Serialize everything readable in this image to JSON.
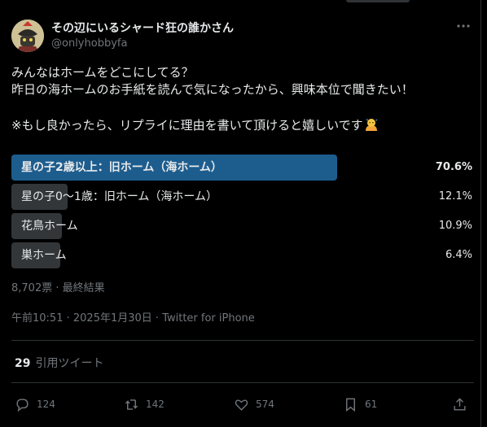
{
  "author": {
    "display_name": "その辺にいるシャード狂の誰かさん",
    "handle": "@onlyhobbyfa"
  },
  "tweet": {
    "line1": "みんなはホームをどこにしてる？",
    "line2": "昨日の海ホームのお手紙を読んで気になったから、興味本位で聞きたい！",
    "line3": "※もし良かったら、リプライに理由を書いて頂けると嬉しいです"
  },
  "poll": {
    "options": [
      {
        "label": "星の子2歳以上：旧ホーム（海ホーム）",
        "percent_text": "70.6%",
        "percent": 70.6,
        "winner": true
      },
      {
        "label": "星の子0〜1歳：旧ホーム（海ホーム）",
        "percent_text": "12.1%",
        "percent": 12.1,
        "winner": false
      },
      {
        "label": "花鳥ホーム",
        "percent_text": "10.9%",
        "percent": 10.9,
        "winner": false
      },
      {
        "label": "巣ホーム",
        "percent_text": "6.4%",
        "percent": 6.4,
        "winner": false
      }
    ],
    "summary": "8,702票 · 最終結果"
  },
  "meta": {
    "time": "午前10:51",
    "date": "2025年1月30日",
    "source": "Twitter for iPhone",
    "separator": " · "
  },
  "quotes": {
    "count": "29",
    "label": "引用ツイート"
  },
  "actions": {
    "replies": "124",
    "retweets": "142",
    "likes": "574",
    "bookmarks": "61"
  },
  "icons": [
    "reply-icon",
    "retweet-icon",
    "like-icon",
    "bookmark-icon",
    "share-icon",
    "more-icon",
    "sweat-emoji"
  ],
  "colors": {
    "background": "#000000",
    "winner_bar": "#1d5d8e",
    "option_bar": "#333639",
    "muted_text": "#71767b",
    "text": "#e7e9ea"
  }
}
